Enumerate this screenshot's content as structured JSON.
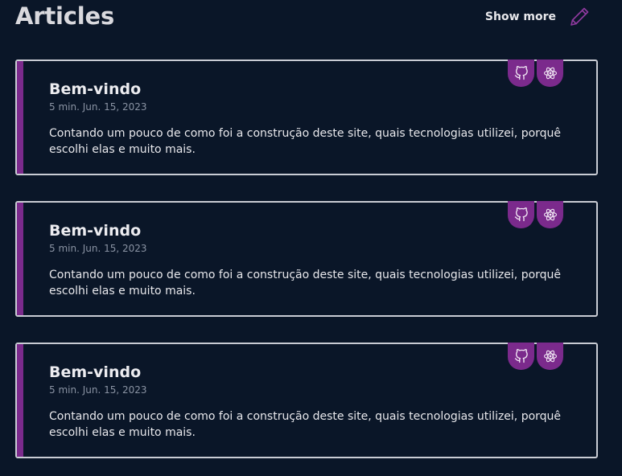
{
  "header": {
    "title": "Articles",
    "show_more_label": "Show more",
    "show_more_icon": "pencil-icon"
  },
  "colors": {
    "background": "#0a1628",
    "accent": "#7b2a8c",
    "card_border": "#c9ccd4",
    "meta_text": "#8a93a3"
  },
  "articles": [
    {
      "title": "Bem-vindo",
      "meta": "5 min. Jun. 15, 2023",
      "description": "Contando um pouco de como foi a construção deste site, quais tecnologias utilizei, porquê escolhi elas e muito mais.",
      "tags": [
        "github-icon",
        "react-icon"
      ]
    },
    {
      "title": "Bem-vindo",
      "meta": "5 min. Jun. 15, 2023",
      "description": "Contando um pouco de como foi a construção deste site, quais tecnologias utilizei, porquê escolhi elas e muito mais.",
      "tags": [
        "github-icon",
        "react-icon"
      ]
    },
    {
      "title": "Bem-vindo",
      "meta": "5 min. Jun. 15, 2023",
      "description": "Contando um pouco de como foi a construção deste site, quais tecnologias utilizei, porquê escolhi elas e muito mais.",
      "tags": [
        "github-icon",
        "react-icon"
      ]
    }
  ]
}
